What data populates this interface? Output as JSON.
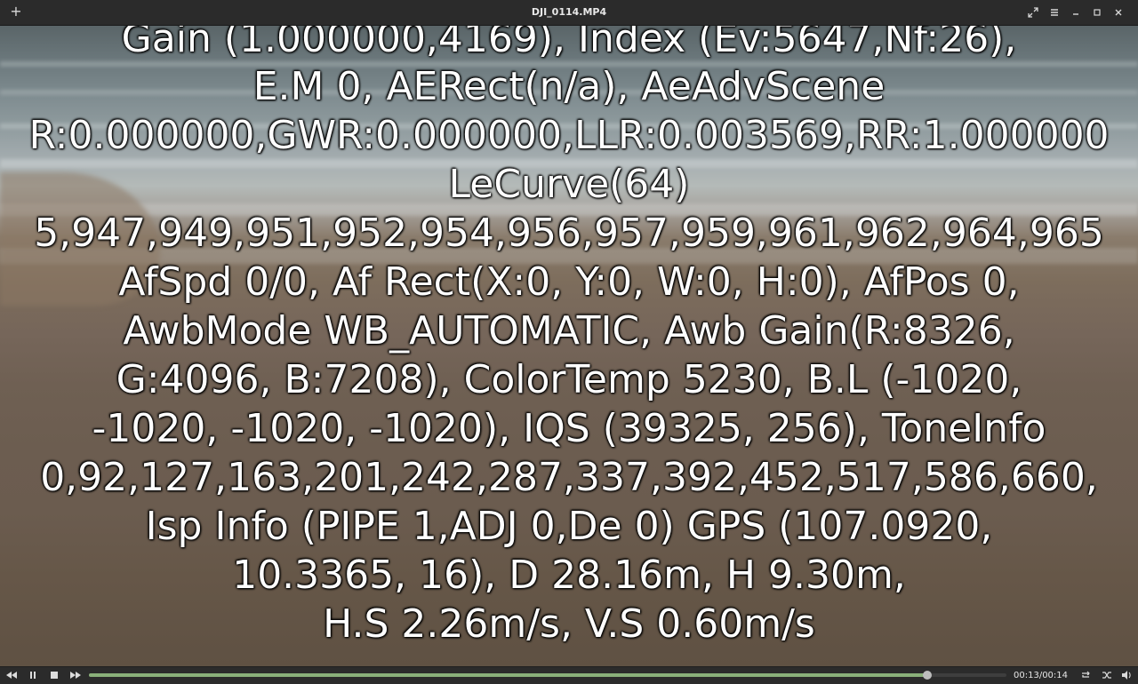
{
  "window": {
    "title": "DJI_0114.MP4",
    "add_icon": "plus-icon",
    "controls": [
      "fullscreen-icon",
      "menu-icon",
      "minimize-icon",
      "maximize-icon",
      "close-icon"
    ]
  },
  "overlay": {
    "lines": [
      "Gain (1.000000,4169), Index (Ev:5647,Nf:26),",
      "E.M 0, AERect(n/a), AeAdvScene",
      "R:0.000000,GWR:0.000000,LLR:0.003569,RR:1.000000",
      "LeCurve(64)",
      "5,947,949,951,952,954,956,957,959,961,962,964,965",
      "AfSpd 0/0, Af Rect(X:0, Y:0, W:0, H:0), AfPos 0,",
      "AwbMode WB_AUTOMATIC, Awb Gain(R:8326,",
      "G:4096, B:7208), ColorTemp 5230, B.L (-1020,",
      "-1020, -1020, -1020), IQS (39325, 256), ToneInfo",
      "0,92,127,163,201,242,287,337,392,452,517,586,660,",
      "Isp Info (PIPE 1,ADJ 0,De 0) GPS (107.0920,",
      "10.3365, 16), D 28.16m, H 9.30m,",
      "H.S 2.26m/s, V.S 0.60m/s"
    ]
  },
  "player": {
    "time_display": "00:13/00:14",
    "progress_fraction": 0.914,
    "accent_color": "#8ab07a"
  }
}
